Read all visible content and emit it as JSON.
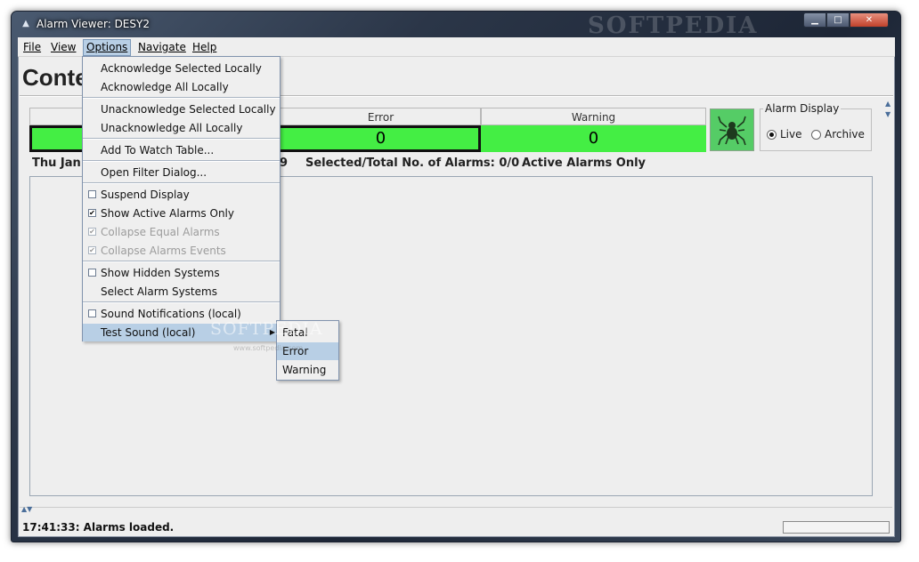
{
  "window": {
    "title": "Alarm Viewer:   DESY2",
    "watermark": "SOFTPEDIA",
    "controls": {
      "minimize": "▁",
      "maximize": "□",
      "close": "✕"
    }
  },
  "menubar": [
    {
      "label": "File"
    },
    {
      "label": "View"
    },
    {
      "label": "Options"
    },
    {
      "label": "Navigate"
    },
    {
      "label": "Help"
    }
  ],
  "content": {
    "title_partial": "Conte",
    "counters": {
      "error_label": "Error",
      "error_value": "0",
      "warning_label": "Warning",
      "warning_value": "0"
    },
    "alarm_display": {
      "title": "Alarm Display",
      "options": [
        {
          "label": "Live",
          "selected": true
        },
        {
          "label": "Archive",
          "selected": false
        }
      ]
    },
    "status": {
      "date_partial": "Thu Jan",
      "digit_partial": "9",
      "selected_total": "Selected/Total No. of Alarms: 0/0",
      "filter": "Active Alarms Only"
    },
    "colors": {
      "counter_green": "#44ee44",
      "menu_highlight": "#b8cfe5",
      "spider_bg": "#55cc66"
    }
  },
  "options_menu": [
    {
      "label": "Acknowledge Selected Locally"
    },
    {
      "label": "Acknowledge All Locally"
    },
    {
      "label": "Unacknowledge Selected Locally"
    },
    {
      "label": "Unacknowledge All Locally"
    },
    {
      "label": "Add To Watch Table..."
    },
    {
      "label": "Open Filter Dialog..."
    },
    {
      "label": "Suspend Display",
      "checked": false
    },
    {
      "label": "Show Active Alarms Only",
      "checked": true
    },
    {
      "label": "Collapse Equal Alarms",
      "checked": true,
      "disabled": true
    },
    {
      "label": "Collapse Alarms Events",
      "checked": true,
      "disabled": true
    },
    {
      "label": "Show Hidden Systems",
      "checked": false
    },
    {
      "label": "Select Alarm Systems"
    },
    {
      "label": "Sound Notifications (local)",
      "checked": false
    },
    {
      "label": "Test Sound (local)",
      "submenu": true
    }
  ],
  "test_sound_submenu": [
    {
      "label": "Fatal"
    },
    {
      "label": "Error"
    },
    {
      "label": "Warning"
    }
  ],
  "footer": {
    "message": "17:41:33: Alarms loaded."
  },
  "overlay": {
    "watermark": "SOFTPEDIA",
    "url": "www.softpedia.com"
  },
  "icons": {
    "app": "app-icon",
    "spider": "spider-icon",
    "check": "check-icon",
    "submenu_arrow": "triangle-right-icon"
  }
}
